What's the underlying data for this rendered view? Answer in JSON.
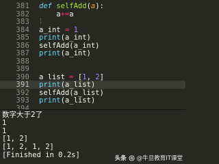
{
  "editor": {
    "theme_colors": {
      "background": "#272822",
      "current_line": "#3b3c36",
      "line_number": "#8f908a",
      "keyword": "#66d9ef",
      "function_name": "#a6e22e",
      "operator": "#f92672",
      "number": "#ae81ff",
      "parameter": "#fd971f",
      "text": "#f8f8f2"
    },
    "current_line_number": "391",
    "lines": [
      {
        "number": "381",
        "tokens": [
          [
            "kw",
            "def"
          ],
          [
            "pl",
            " "
          ],
          [
            "fn",
            "selfAdd"
          ],
          [
            "pl",
            "("
          ],
          [
            "pm",
            "a"
          ],
          [
            "pl",
            "):"
          ]
        ]
      },
      {
        "number": "382",
        "tokens": [
          [
            "pl",
            "    a"
          ],
          [
            "op",
            "+="
          ],
          [
            "pl",
            "a"
          ]
        ]
      },
      {
        "number": "383",
        "tokens": []
      },
      {
        "number": "384",
        "tokens": [
          [
            "pl",
            "a_int "
          ],
          [
            "op",
            "="
          ],
          [
            "pl",
            " "
          ],
          [
            "num",
            "1"
          ]
        ]
      },
      {
        "number": "385",
        "tokens": [
          [
            "bi",
            "print"
          ],
          [
            "pl",
            "(a_int)"
          ]
        ]
      },
      {
        "number": "386",
        "tokens": [
          [
            "pl",
            "selfAdd(a_int)"
          ]
        ]
      },
      {
        "number": "387",
        "tokens": [
          [
            "bi",
            "print"
          ],
          [
            "pl",
            "(a_int)"
          ]
        ]
      },
      {
        "number": "388",
        "tokens": []
      },
      {
        "number": "389",
        "tokens": []
      },
      {
        "number": "390",
        "tokens": [
          [
            "pl",
            "a_list "
          ],
          [
            "op",
            "="
          ],
          [
            "pl",
            " ["
          ],
          [
            "num",
            "1"
          ],
          [
            "pl",
            ", "
          ],
          [
            "num",
            "2"
          ],
          [
            "pl",
            "]"
          ]
        ]
      },
      {
        "number": "391",
        "tokens": [
          [
            "bi",
            "print"
          ],
          [
            "pl",
            "(a_list)"
          ]
        ]
      },
      {
        "number": "392",
        "tokens": [
          [
            "pl",
            "selfAdd(a_list)"
          ]
        ]
      },
      {
        "number": "393",
        "tokens": [
          [
            "bi",
            "print"
          ],
          [
            "pl",
            "(a_list)"
          ]
        ]
      },
      {
        "number": "394",
        "tokens": []
      }
    ]
  },
  "output": {
    "lines": [
      "数字大于2了",
      "1",
      "1",
      "[1, 2]",
      "[1, 2, 1, 2]",
      "[Finished in 0.2s]"
    ]
  },
  "watermark": {
    "app": "头条",
    "handle": "@牛旦教育IT课堂"
  }
}
